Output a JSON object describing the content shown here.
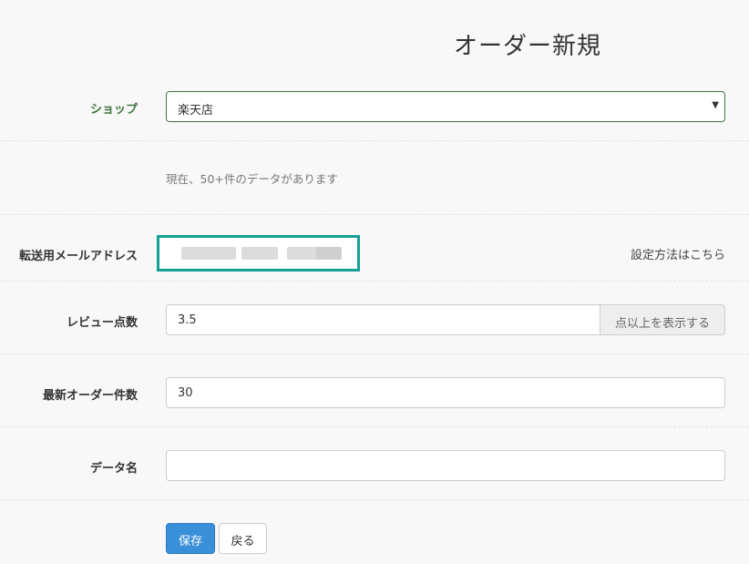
{
  "page": {
    "title": "オーダー新規"
  },
  "shop": {
    "label": "ショップ",
    "value": "楽天店"
  },
  "info": {
    "text": "現在、50+件のデータがあります"
  },
  "email": {
    "label": "転送用メールアドレス",
    "help_link": "設定方法はこちら"
  },
  "review": {
    "label": "レビュー点数",
    "value": "3.5",
    "suffix": "点以上を表示する"
  },
  "latest": {
    "label": "最新オーダー件数",
    "value": "30"
  },
  "dataname": {
    "label": "データ名",
    "value": ""
  },
  "actions": {
    "save": "保存",
    "back": "戻る"
  },
  "colors": {
    "accent_teal": "#16a095",
    "primary": "#3a8fd9",
    "label_green": "#3c763d"
  }
}
